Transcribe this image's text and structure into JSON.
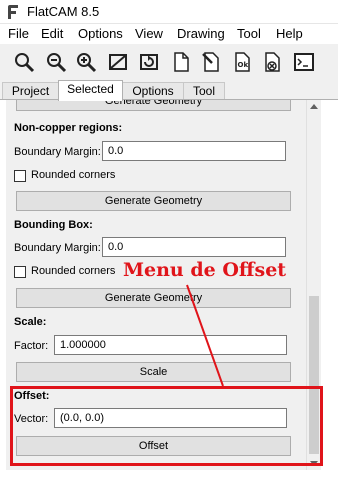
{
  "window": {
    "title": "FlatCAM 8.5"
  },
  "menubar": {
    "items": [
      "File",
      "Edit",
      "Options",
      "View",
      "Drawing",
      "Tool",
      "Help"
    ]
  },
  "toolbar": {
    "icons": [
      "zoom-fit-icon",
      "zoom-out-icon",
      "zoom-in-icon",
      "clear-plot-icon",
      "replot-icon",
      "new-geometry-icon",
      "edit-geometry-icon",
      "update-geometry-icon",
      "delete-icon",
      "shell-icon"
    ]
  },
  "tabs": [
    "Project",
    "Selected",
    "Options",
    "Tool"
  ],
  "active_tab": "Selected",
  "panel": {
    "top_button": "Generate Geometry",
    "noncopper": {
      "heading": "Non-copper regions:",
      "margin_label": "Boundary Margin:",
      "margin_value": "0.0",
      "rounded_label": "Rounded corners",
      "button": "Generate Geometry"
    },
    "bounding": {
      "heading": "Bounding Box:",
      "margin_label": "Boundary Margin:",
      "margin_value": "0.0",
      "rounded_label": "Rounded corners",
      "button": "Generate Geometry"
    },
    "scale": {
      "heading": "Scale:",
      "factor_label": "Factor:",
      "factor_value": "1.000000",
      "button": "Scale"
    },
    "offset": {
      "heading": "Offset:",
      "vector_label": "Vector:",
      "vector_value": "(0.0, 0.0)",
      "button": "Offset"
    }
  },
  "annotation": {
    "text": "Menu de Offset",
    "color": "#e0141a"
  }
}
